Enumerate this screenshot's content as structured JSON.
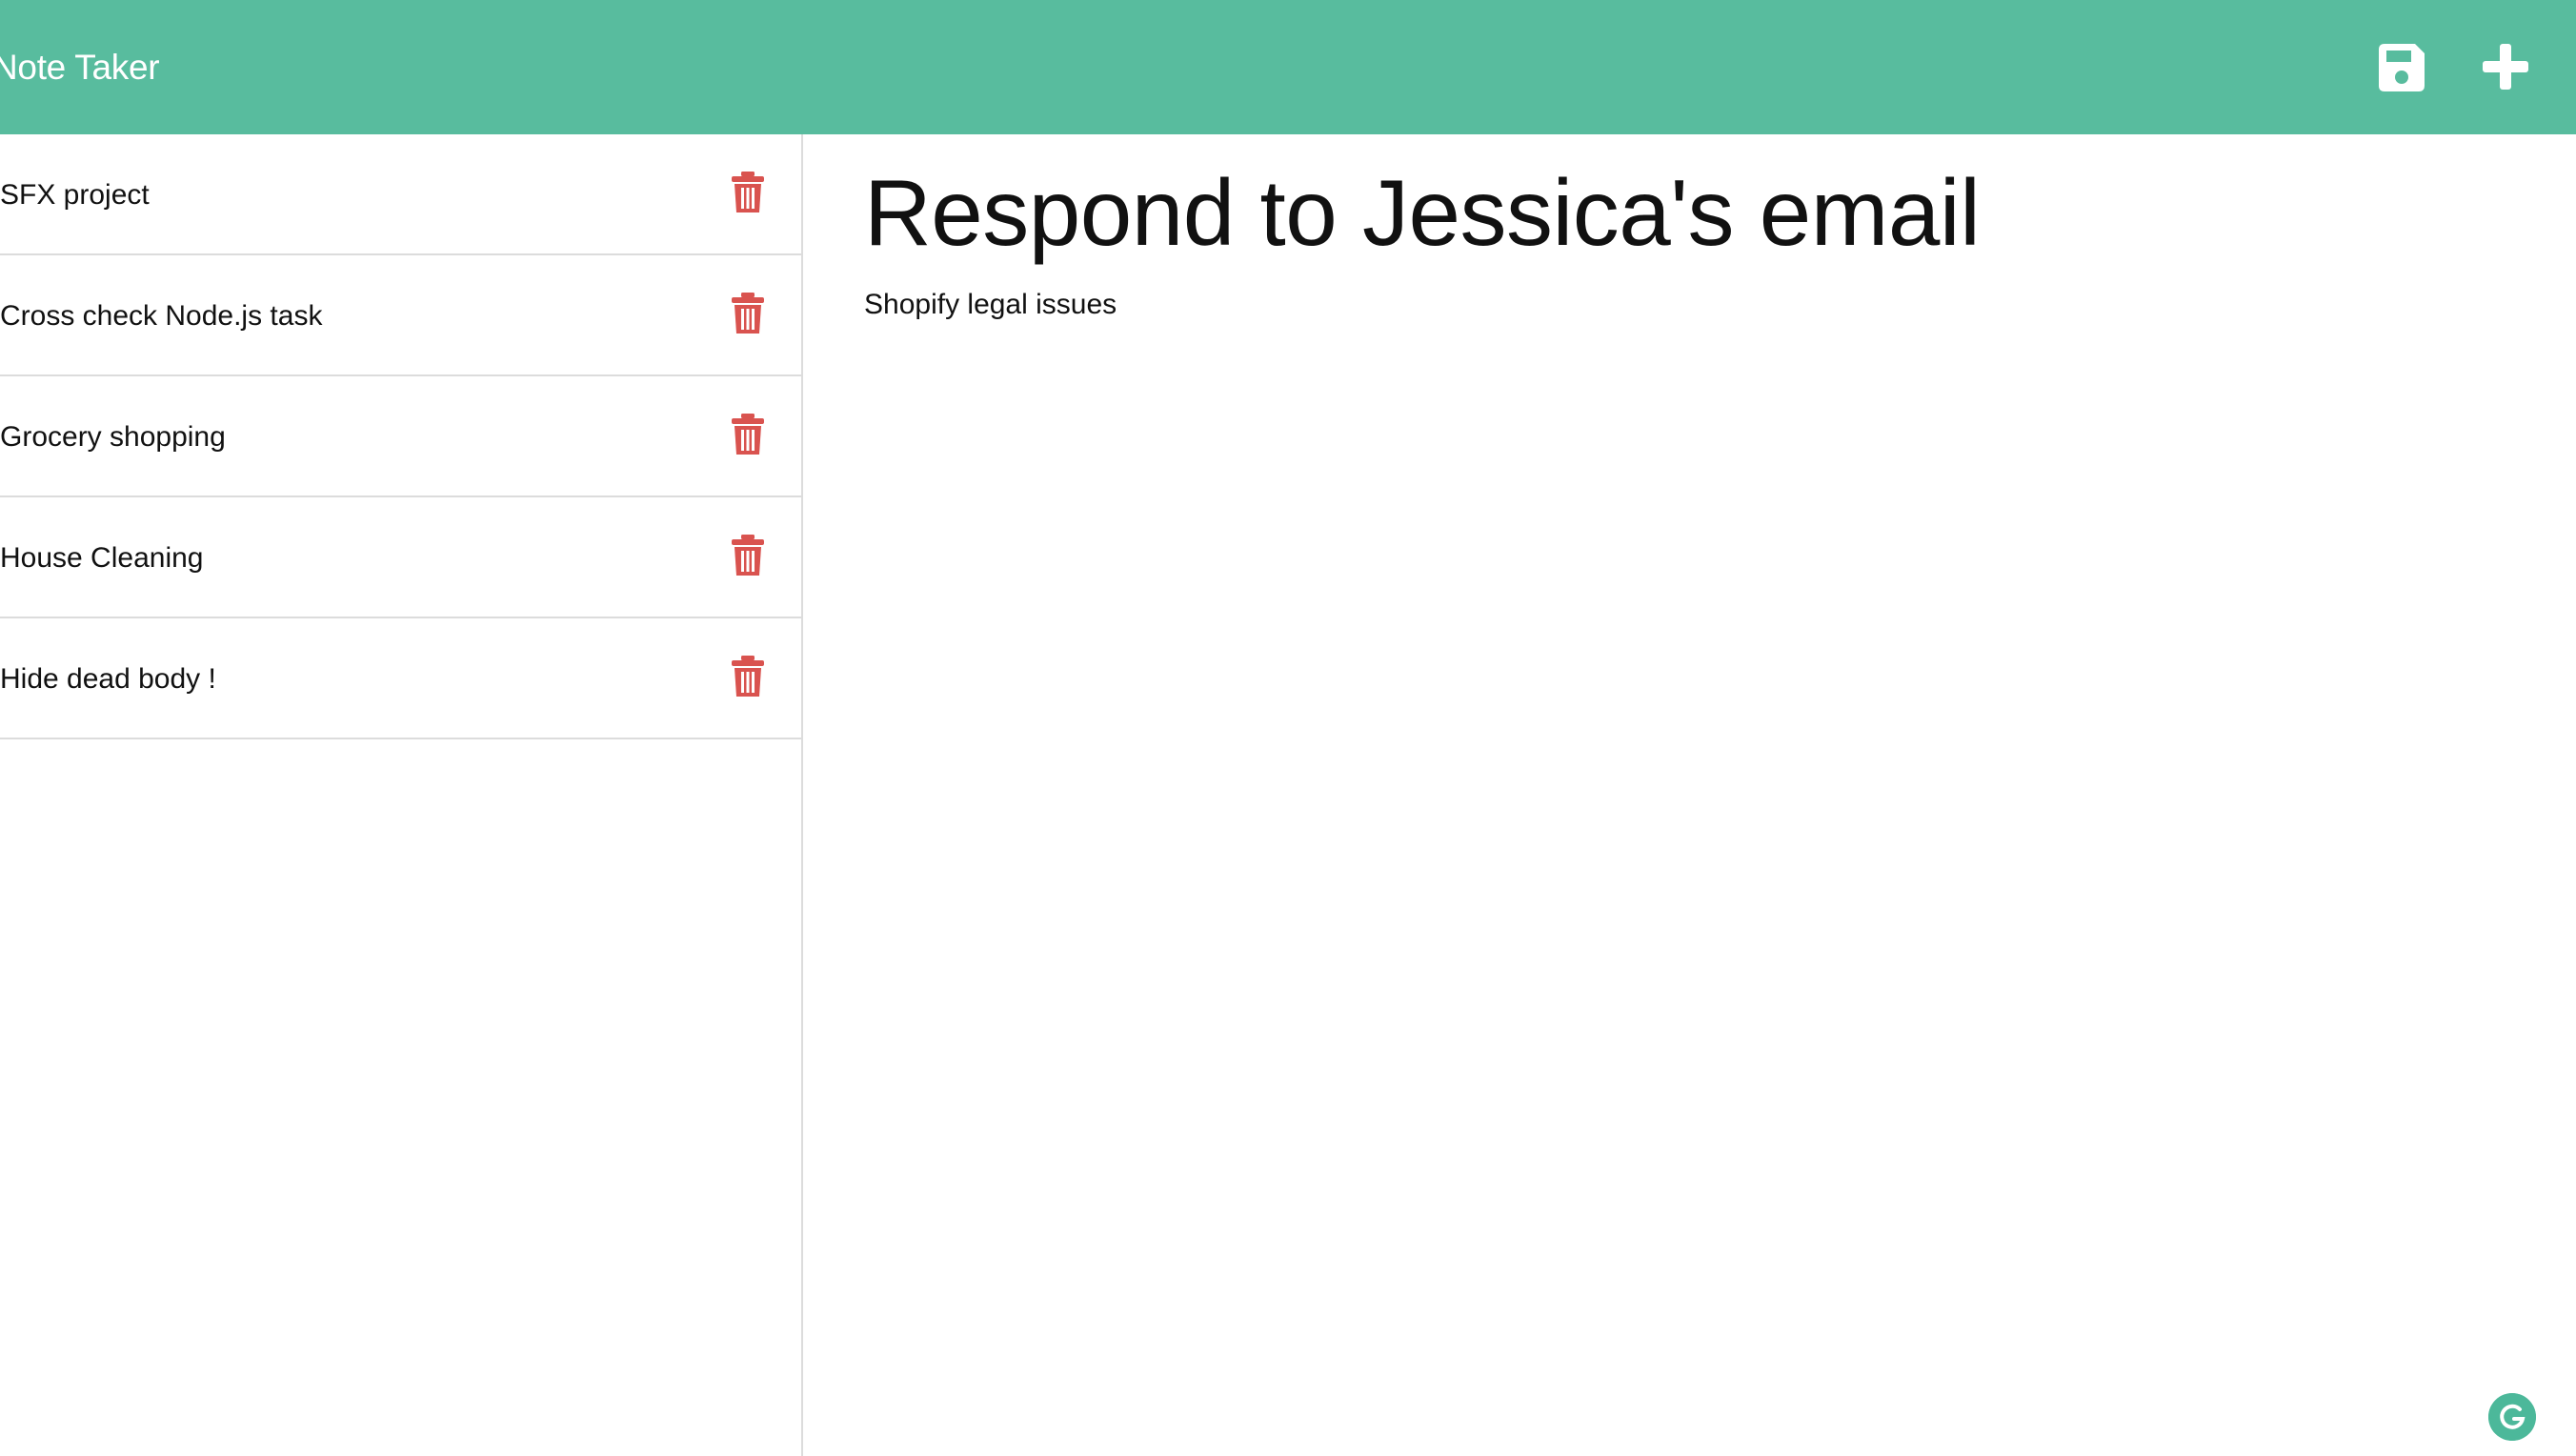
{
  "app": {
    "title": "Note Taker",
    "accent_color": "#58bc9e",
    "delete_color": "#d9534f"
  },
  "toolbar": {
    "save_icon": "floppy-disk-icon",
    "new_icon": "plus-icon"
  },
  "notes": [
    {
      "title": "SFX project"
    },
    {
      "title": "Cross check Node.js task"
    },
    {
      "title": "Grocery shopping"
    },
    {
      "title": "House Cleaning"
    },
    {
      "title": "Hide dead body !"
    }
  ],
  "active_note": {
    "title": "Respond to Jessica's email",
    "text": "Shopify legal issues"
  },
  "widgets": {
    "grammarly_icon": "grammarly-icon"
  }
}
